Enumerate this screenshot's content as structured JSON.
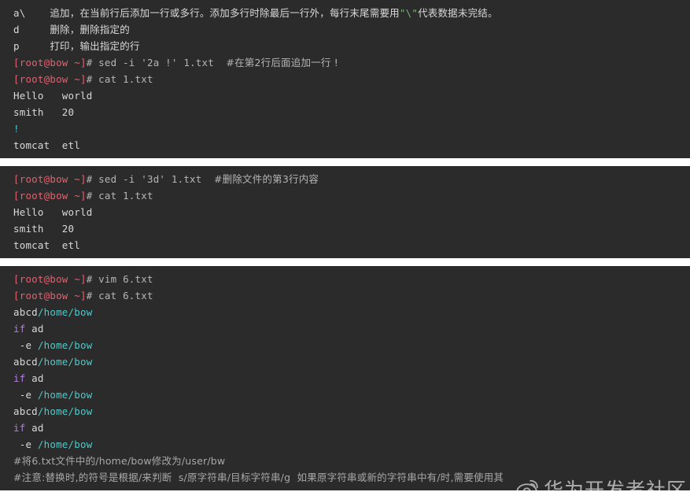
{
  "page": {
    "background": "#ffffff",
    "terminal_background": "#2b2b2b",
    "colors": {
      "prompt_red": "#e0626f",
      "text_white": "#d8d8d8",
      "path_cyan": "#4ec9c9",
      "keyword_purple": "#b07fd8",
      "escape_green": "#7fae7f",
      "comment_gray": "#a8a8a8"
    }
  },
  "watermark": {
    "text": "华为开发者社区",
    "logo": "weibo-eye-icon"
  },
  "blocks": [
    {
      "id": "block-1",
      "lines": [
        {
          "id": "b1l1",
          "segments": [
            {
              "text": "a\\    ",
              "style": "c-white"
            },
            {
              "text": "追加，在当前行后添加一行或多行。添加多行时除最后一行外，每行末尾需要用",
              "style": "c-white cjk"
            },
            {
              "text": "\"\\\"",
              "style": "c-green"
            },
            {
              "text": "代表数据未完结。",
              "style": "c-white cjk"
            }
          ]
        },
        {
          "id": "b1l2",
          "segments": [
            {
              "text": "d     ",
              "style": "c-white"
            },
            {
              "text": "删除，删除指定的",
              "style": "c-white cjk"
            }
          ]
        },
        {
          "id": "b1l3",
          "segments": [
            {
              "text": "p     ",
              "style": "c-white"
            },
            {
              "text": "打印，输出指定的行",
              "style": "c-white cjk"
            }
          ]
        },
        {
          "id": "b1l4",
          "segments": [
            {
              "text": "[root@bow ~]",
              "style": "c-prompt"
            },
            {
              "text": "# sed -i '2a !' 1.txt  ",
              "style": "c-gray"
            },
            {
              "text": "#在第2行后面追加一行 !",
              "style": "c-gray cjk"
            }
          ]
        },
        {
          "id": "b1l5",
          "segments": [
            {
              "text": "[root@bow ~]",
              "style": "c-prompt"
            },
            {
              "text": "# cat 1.txt",
              "style": "c-gray"
            }
          ]
        },
        {
          "id": "b1l6",
          "segments": [
            {
              "text": "Hello   world",
              "style": "c-white"
            }
          ]
        },
        {
          "id": "b1l7",
          "segments": [
            {
              "text": "smith   20",
              "style": "c-white"
            }
          ]
        },
        {
          "id": "b1l8",
          "segments": [
            {
              "text": "!",
              "style": "c-cyan"
            }
          ]
        },
        {
          "id": "b1l9",
          "segments": [
            {
              "text": "tomcat  etl",
              "style": "c-white"
            }
          ]
        }
      ]
    },
    {
      "id": "block-2",
      "lines": [
        {
          "id": "b2l1",
          "segments": [
            {
              "text": "[root@bow ~]",
              "style": "c-prompt"
            },
            {
              "text": "# sed -i '3d' 1.txt  ",
              "style": "c-gray"
            },
            {
              "text": "#删除文件的第3行内容",
              "style": "c-gray cjk"
            }
          ]
        },
        {
          "id": "b2l2",
          "segments": [
            {
              "text": "[root@bow ~]",
              "style": "c-prompt"
            },
            {
              "text": "# cat 1.txt",
              "style": "c-gray"
            }
          ]
        },
        {
          "id": "b2l3",
          "segments": [
            {
              "text": "Hello   world",
              "style": "c-white"
            }
          ]
        },
        {
          "id": "b2l4",
          "segments": [
            {
              "text": "smith   20",
              "style": "c-white"
            }
          ]
        },
        {
          "id": "b2l5",
          "segments": [
            {
              "text": "tomcat  etl",
              "style": "c-white"
            }
          ]
        }
      ]
    },
    {
      "id": "block-3",
      "lines": [
        {
          "id": "b3l1",
          "segments": [
            {
              "text": "[root@bow ~]",
              "style": "c-prompt"
            },
            {
              "text": "# vim 6.txt",
              "style": "c-gray"
            }
          ]
        },
        {
          "id": "b3l2",
          "segments": [
            {
              "text": "[root@bow ~]",
              "style": "c-prompt"
            },
            {
              "text": "# cat 6.txt",
              "style": "c-gray"
            }
          ]
        },
        {
          "id": "b3l3",
          "segments": [
            {
              "text": "abcd",
              "style": "c-white"
            },
            {
              "text": "/home/bow",
              "style": "c-cyan"
            }
          ]
        },
        {
          "id": "b3l4",
          "segments": [
            {
              "text": "if",
              "style": "c-purple"
            },
            {
              "text": " ad",
              "style": "c-white"
            }
          ]
        },
        {
          "id": "b3l5",
          "segments": [
            {
              "text": " -e ",
              "style": "c-white"
            },
            {
              "text": "/home/bow",
              "style": "c-cyan"
            }
          ]
        },
        {
          "id": "b3l6",
          "segments": [
            {
              "text": "abcd",
              "style": "c-white"
            },
            {
              "text": "/home/bow",
              "style": "c-cyan"
            }
          ]
        },
        {
          "id": "b3l7",
          "segments": [
            {
              "text": "if",
              "style": "c-purple"
            },
            {
              "text": " ad",
              "style": "c-white"
            }
          ]
        },
        {
          "id": "b3l8",
          "segments": [
            {
              "text": " -e ",
              "style": "c-white"
            },
            {
              "text": "/home/bow",
              "style": "c-cyan"
            }
          ]
        },
        {
          "id": "b3l9",
          "segments": [
            {
              "text": "abcd",
              "style": "c-white"
            },
            {
              "text": "/home/bow",
              "style": "c-cyan"
            }
          ]
        },
        {
          "id": "b3l10",
          "segments": [
            {
              "text": "if",
              "style": "c-purple"
            },
            {
              "text": " ad",
              "style": "c-white"
            }
          ]
        },
        {
          "id": "b3l11",
          "segments": [
            {
              "text": " -e ",
              "style": "c-white"
            },
            {
              "text": "/home/bow",
              "style": "c-cyan"
            }
          ]
        },
        {
          "id": "b3l12",
          "segments": [
            {
              "text": "#将6.txt文件中的/home/bow修改为/user/bw",
              "style": "c-comment cjk"
            }
          ]
        },
        {
          "id": "b3l13",
          "segments": [
            {
              "text": "#注意:替换时,的符号是根据/来判断  s/原字符串/目标字符串/g  如果原字符串或新的字符串中有/时,需要使用其",
              "style": "c-comment cjk"
            }
          ]
        }
      ]
    }
  ]
}
